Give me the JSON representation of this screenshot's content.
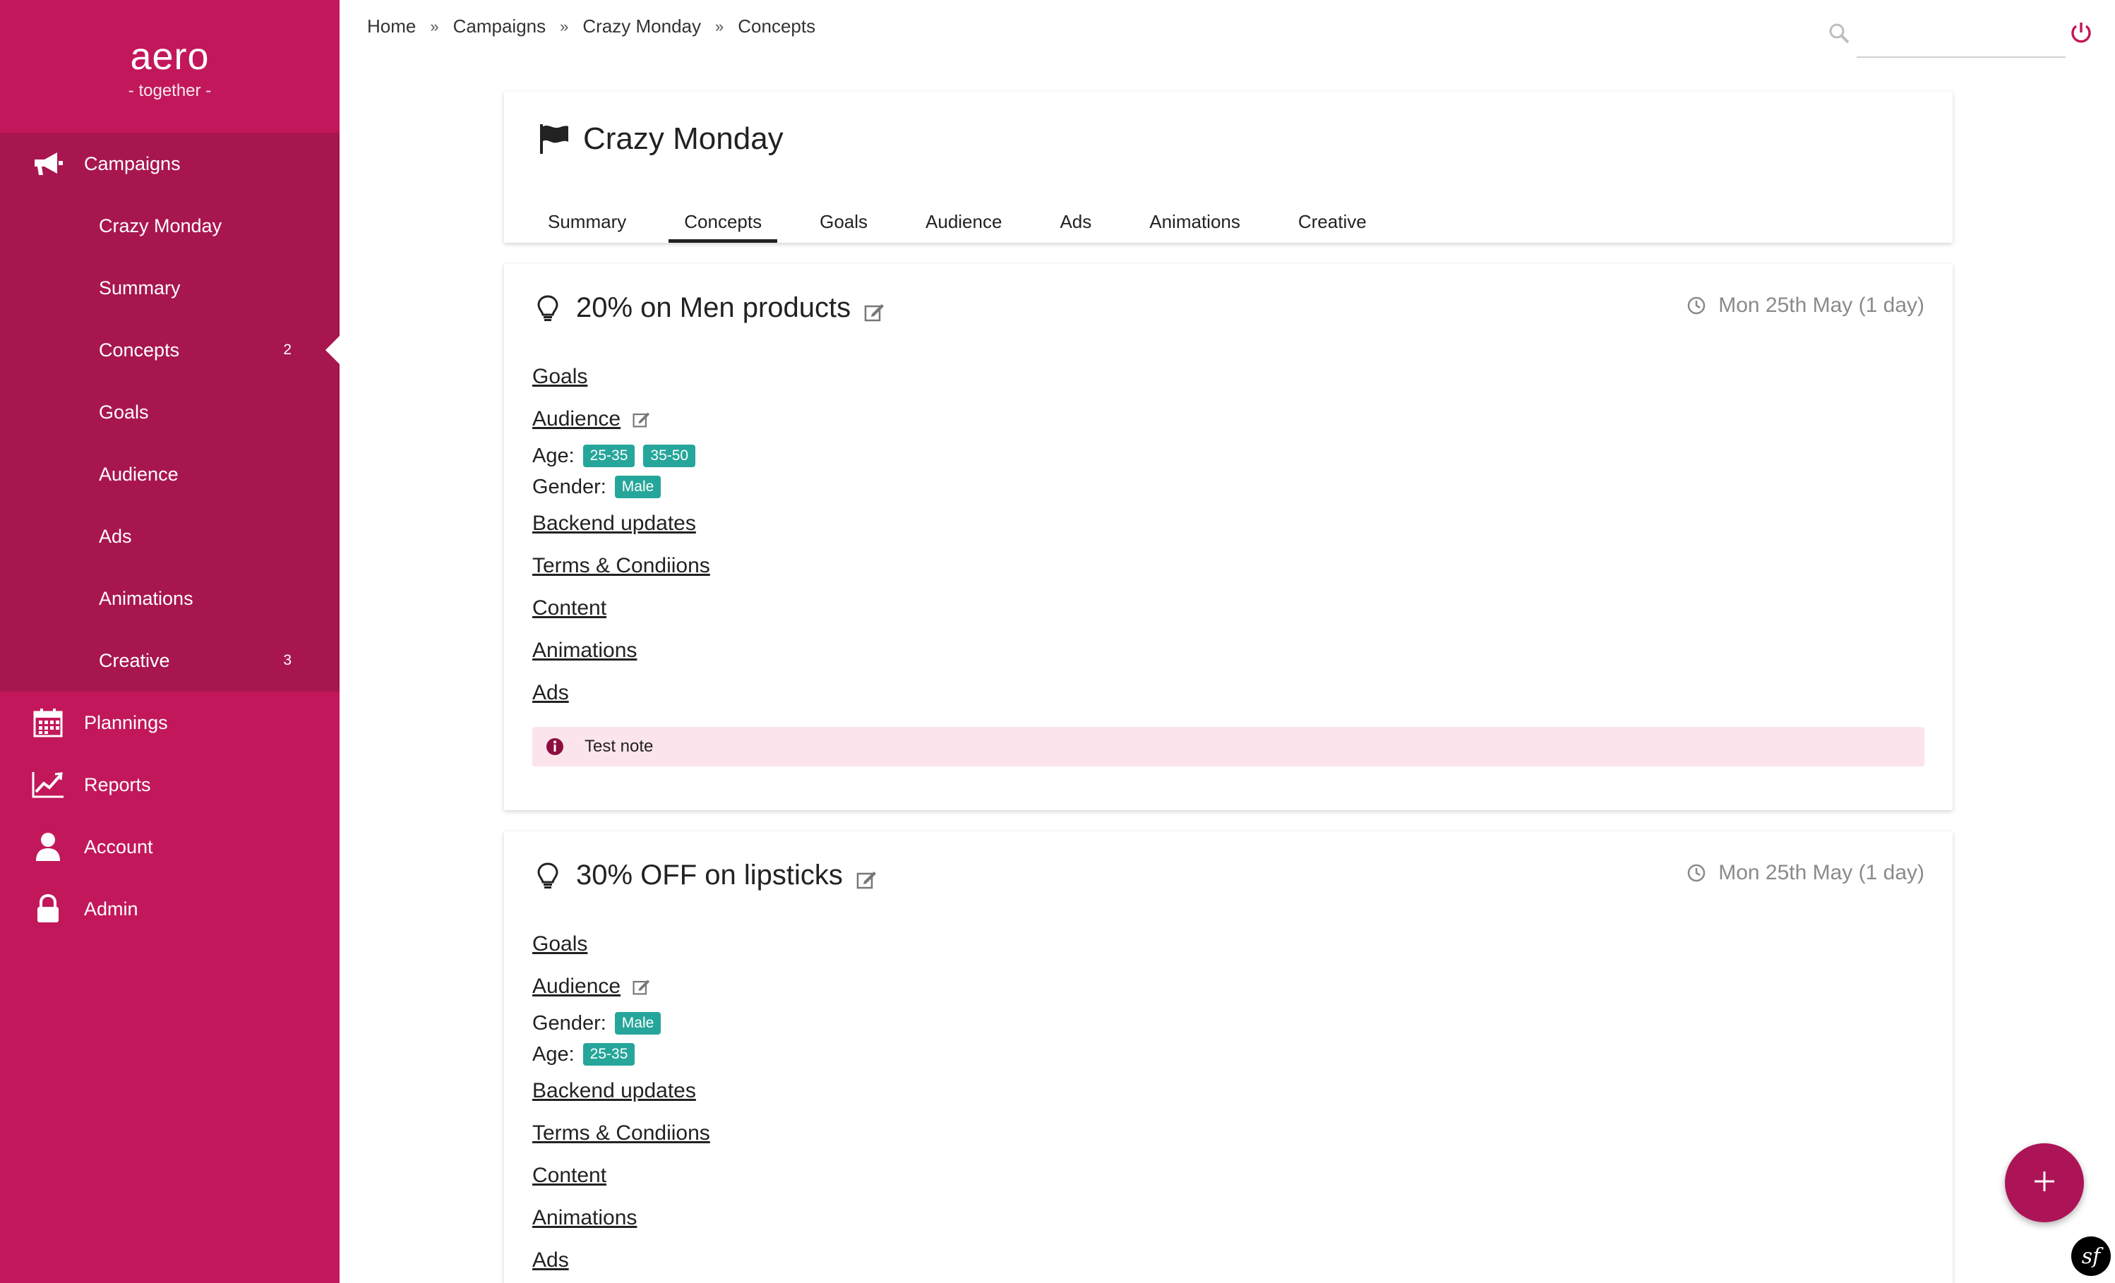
{
  "brand": {
    "name": "aero",
    "tagline": "- together -"
  },
  "sidebar": {
    "campaigns": "Campaigns",
    "sub_items": [
      {
        "label": "Crazy Monday",
        "count": ""
      },
      {
        "label": "Summary",
        "count": ""
      },
      {
        "label": "Concepts",
        "count": "2"
      },
      {
        "label": "Goals",
        "count": ""
      },
      {
        "label": "Audience",
        "count": ""
      },
      {
        "label": "Ads",
        "count": ""
      },
      {
        "label": "Animations",
        "count": ""
      },
      {
        "label": "Creative",
        "count": "3"
      }
    ],
    "plannings": "Plannings",
    "reports": "Reports",
    "account": "Account",
    "admin": "Admin"
  },
  "breadcrumb": [
    "Home",
    "Campaigns",
    "Crazy Monday",
    "Concepts"
  ],
  "search": {
    "placeholder": ""
  },
  "header": {
    "title": "Crazy Monday",
    "tabs": [
      "Summary",
      "Concepts",
      "Goals",
      "Audience",
      "Ads",
      "Animations",
      "Creative"
    ],
    "active_tab": "Concepts"
  },
  "concepts": [
    {
      "title": "20% on Men products",
      "date": "Mon 25th May (1 day)",
      "goals": "Goals",
      "audience": "Audience",
      "attr1_label": "Age:",
      "attr1_tags": [
        "25-35",
        "35-50"
      ],
      "attr2_label": "Gender:",
      "attr2_tags": [
        "Male"
      ],
      "links": [
        "Backend updates",
        "Terms & Condiions",
        "Content",
        "Animations",
        "Ads"
      ],
      "note": "Test note"
    },
    {
      "title": "30% OFF on lipsticks",
      "date": "Mon 25th May (1 day)",
      "goals": "Goals",
      "audience": "Audience",
      "attr1_label": "Gender:",
      "attr1_tags": [
        "Male"
      ],
      "attr2_label": "Age:",
      "attr2_tags": [
        "25-35"
      ],
      "links": [
        "Backend updates",
        "Terms & Condiions",
        "Content",
        "Animations",
        "Ads"
      ]
    }
  ],
  "colors": {
    "sidebar": "#c2185b",
    "sidebar_group": "#a8164f",
    "tag": "#26a69a",
    "note_bg": "#fce4ec",
    "fab": "#ad1457"
  },
  "icons": [
    "megaphone-icon",
    "calendar-icon",
    "chart-icon",
    "user-icon",
    "lock-icon",
    "search-icon",
    "power-icon",
    "flag-icon",
    "bulb-icon",
    "edit-icon",
    "clock-icon",
    "info-icon",
    "plus-icon"
  ]
}
